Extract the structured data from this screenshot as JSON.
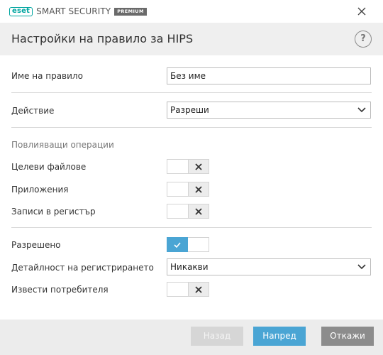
{
  "window": {
    "brand": "eset",
    "product": "SMART SECURITY",
    "edition": "PREMIUM"
  },
  "header": {
    "title": "Настройки на правило за HIPS",
    "help_label": "?"
  },
  "form": {
    "rule_name": {
      "label": "Име на правило",
      "value": "Без име"
    },
    "action": {
      "label": "Действие",
      "value": "Разреши"
    },
    "operations_title": "Повлияващи операции",
    "target_files": {
      "label": "Целеви файлове",
      "enabled": false
    },
    "applications": {
      "label": "Приложения",
      "enabled": false
    },
    "registry_entries": {
      "label": "Записи в регистър",
      "enabled": false
    },
    "enabled": {
      "label": "Разрешено",
      "enabled": true
    },
    "logging_severity": {
      "label": "Детайлност на регистрирането",
      "value": "Никакви"
    },
    "notify_user": {
      "label": "Извести потребителя",
      "enabled": false
    }
  },
  "footer": {
    "back_label": "Назад",
    "next_label": "Напред",
    "cancel_label": "Откажи"
  },
  "colors": {
    "accent": "#4aa5d4",
    "brand": "#00a5a0",
    "disabled_button": "#d6d6d6",
    "cancel_button": "#8c8c8c"
  }
}
